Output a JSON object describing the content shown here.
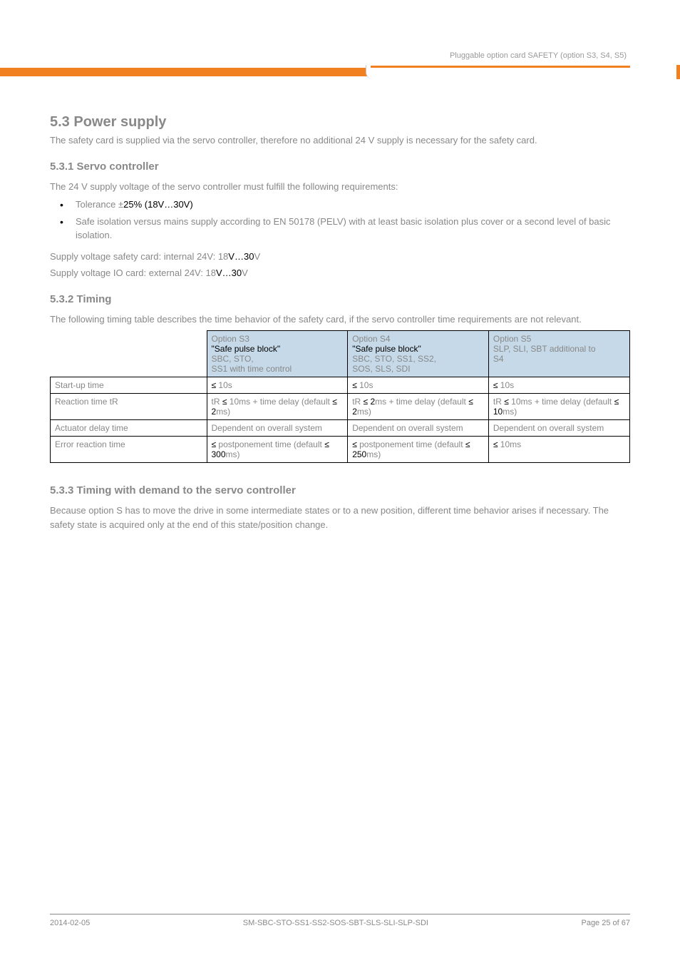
{
  "header": {
    "right_text": "Pluggable option card SAFETY (option S3, S4, S5)"
  },
  "section": {
    "number": "5.3",
    "title": "Power supply",
    "para1": "The safety card is supplied via the servo controller, therefore no additional 24 V supply is necessary for the safety card.",
    "subsection1_title": "5.3.1 Servo controller",
    "subsection1_text": "The 24 V supply voltage of the servo controller must fulfill the following requirements:",
    "bullets": [
      "Tolerance ±25% (18V…30V)",
      "Safe isolation versus mains supply according to EN 50178 (PELV) with at least basic isolation plus cover or a second level of basic isolation."
    ],
    "note1_line1": "Supply voltage safety card: internal 24V: 18V…30V",
    "note1_line2": "Supply voltage IO card: external 24V: 18V…30V",
    "subsection2_title": "5.3.2 Timing",
    "subsection2_para": "The following timing table describes the time behavior of the safety card, if the servo controller time requirements are not relevant.",
    "followup_title": "5.3.3 Timing with demand to the servo controller",
    "followup_para": "Because option S has to move the drive in some intermediate states or to a new position, different time behavior arises if necessary. The safety state is acquired only at the end of this state/position change."
  },
  "table": {
    "headers": {
      "col1_empty": "",
      "col2_line1": "Option S3",
      "col2_line2": "\"Safe pulse block\"",
      "col2_line3": "SBC, STO,",
      "col2_line4": "SS1 with time control",
      "col3_line1": "Option S4",
      "col3_line2": "\"Safe pulse block\"",
      "col3_line3": "SBC, STO, SS1, SS2,",
      "col3_line4": "SOS, SLS, SDI",
      "col4_line1": "Option S5",
      "col4_line2": "SLP, SLI, SBT additional to",
      "col4_line3": "S4"
    },
    "rows": [
      {
        "label": "Start-up time",
        "c2": "≤ 10s",
        "c3": "≤ 10s",
        "c4": "≤ 10s"
      },
      {
        "label": "Reaction time tR",
        "c2": "tR ≤ 10ms + time delay (default ≤ 2ms)",
        "c3": "tR ≤ 2ms + time delay (default ≤ 2ms)",
        "c4": "tR ≤ 10ms + time delay (default ≤ 10ms)"
      },
      {
        "label": "Actuator delay time",
        "c2": "Dependent on overall system",
        "c3": "Dependent on overall system",
        "c4": "Dependent on overall system"
      },
      {
        "label": "Error reaction time",
        "c2": "≤ postponement time (default ≤ 300ms)",
        "c3": "≤ postponement time (default ≤ 250ms)",
        "c4": "≤ 10ms"
      }
    ]
  },
  "footer": {
    "left": "2014-02-05",
    "center": "SM-SBC-STO-SS1-SS2-SOS-SBT-SLS-SLI-SLP-SDI",
    "right": "Page 25 of 67"
  }
}
